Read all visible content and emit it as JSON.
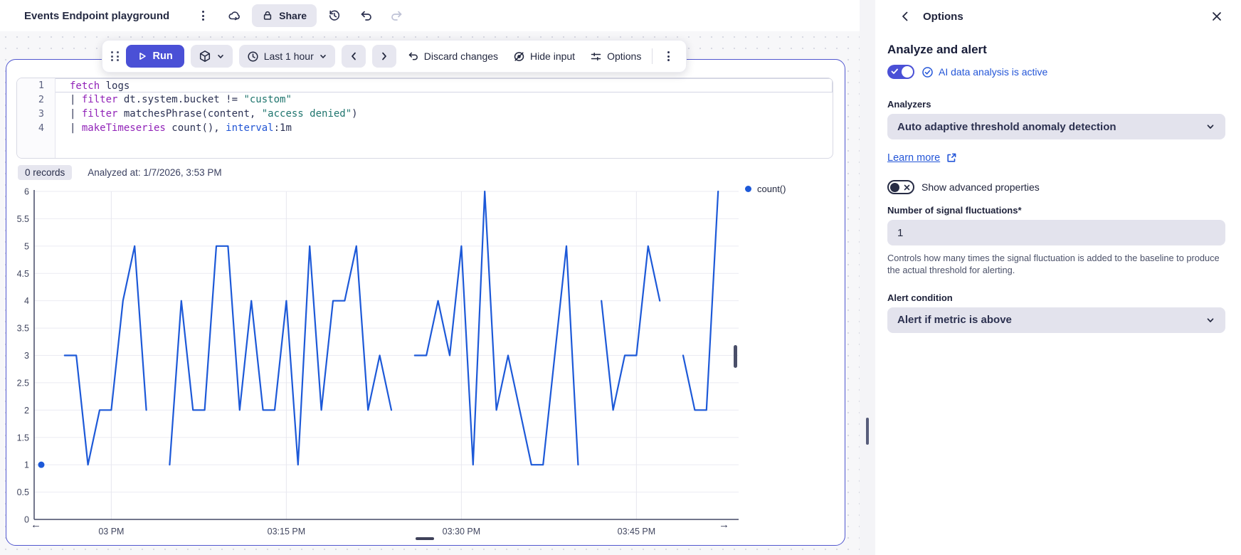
{
  "header": {
    "title": "Events Endpoint playground",
    "share_label": "Share"
  },
  "toolbar": {
    "run_label": "Run",
    "time_range": "Last 1 hour",
    "discard_label": "Discard changes",
    "hide_input_label": "Hide input",
    "options_label": "Options"
  },
  "editor": {
    "lines": [
      {
        "num": "1",
        "tokens": [
          {
            "t": "fetch",
            "c": "kw"
          },
          {
            "t": " logs",
            "c": "plain"
          }
        ]
      },
      {
        "num": "2",
        "tokens": [
          {
            "t": "| ",
            "c": "plain"
          },
          {
            "t": "filter",
            "c": "kw"
          },
          {
            "t": " dt.system.bucket != ",
            "c": "plain"
          },
          {
            "t": "\"custom\"",
            "c": "str"
          }
        ]
      },
      {
        "num": "3",
        "tokens": [
          {
            "t": "| ",
            "c": "plain"
          },
          {
            "t": "filter",
            "c": "kw"
          },
          {
            "t": " matchesPhrase(content, ",
            "c": "plain"
          },
          {
            "t": "\"access denied\"",
            "c": "str"
          },
          {
            "t": ")",
            "c": "plain"
          }
        ]
      },
      {
        "num": "4",
        "tokens": [
          {
            "t": "| ",
            "c": "plain"
          },
          {
            "t": "makeTimeseries",
            "c": "kw"
          },
          {
            "t": " count(), ",
            "c": "plain"
          },
          {
            "t": "interval",
            "c": "param"
          },
          {
            "t": ":1m",
            "c": "plain"
          }
        ]
      }
    ]
  },
  "results": {
    "records_badge": "0 records",
    "analyzed_at": "Analyzed at: 1/7/2026, 3:53 PM"
  },
  "chart_data": {
    "type": "line",
    "title": "",
    "xlabel": "",
    "ylabel": "",
    "ylim": [
      0,
      6
    ],
    "y_ticks": [
      0,
      0.5,
      1,
      1.5,
      2,
      2.5,
      3,
      3.5,
      4,
      4.5,
      5,
      5.5,
      6
    ],
    "x_start": "2:54 PM",
    "x_interval": "1m",
    "x_tick_labels": [
      "03 PM",
      "03:15 PM",
      "03:30 PM",
      "03:45 PM"
    ],
    "x_tick_indices": [
      6,
      21,
      36,
      51
    ],
    "grid": true,
    "legend_position": "top-right",
    "series": [
      {
        "name": "count()",
        "color": "#1d59d8",
        "values": [
          1,
          null,
          3,
          3,
          1,
          2,
          2,
          4,
          5,
          2,
          null,
          1,
          4,
          2,
          2,
          5,
          5,
          2,
          4,
          2,
          2,
          4,
          1,
          5,
          2,
          4,
          4,
          5,
          2,
          3,
          2,
          null,
          3,
          3,
          4,
          3,
          5,
          1,
          6,
          2,
          3,
          2,
          1,
          1,
          3,
          5,
          1,
          null,
          4,
          2,
          3,
          3,
          5,
          4,
          null,
          3,
          2,
          2,
          6,
          null
        ]
      }
    ]
  },
  "side_panel": {
    "title": "Options",
    "section_title": "Analyze and alert",
    "ai_status": "AI data analysis is active",
    "analyzers_label": "Analyzers",
    "analyzer_value": "Auto adaptive threshold anomaly detection",
    "learn_more_label": "Learn more",
    "advanced_toggle_label": "Show advanced properties",
    "fluctuations_label": "Number of signal fluctuations*",
    "fluctuations_value": "1",
    "fluctuations_help": "Controls how many times the signal fluctuation is added to the baseline to produce the actual threshold for alerting.",
    "alert_condition_label": "Alert condition",
    "alert_condition_value": "Alert if metric is above"
  },
  "colors": {
    "primary": "#4a50d6",
    "link_blue": "#2456d8",
    "line_blue": "#1d59d8",
    "card_border": "#5157cf",
    "pill_gray": "#e7e7f0",
    "field_gray": "#e3e3ed"
  }
}
